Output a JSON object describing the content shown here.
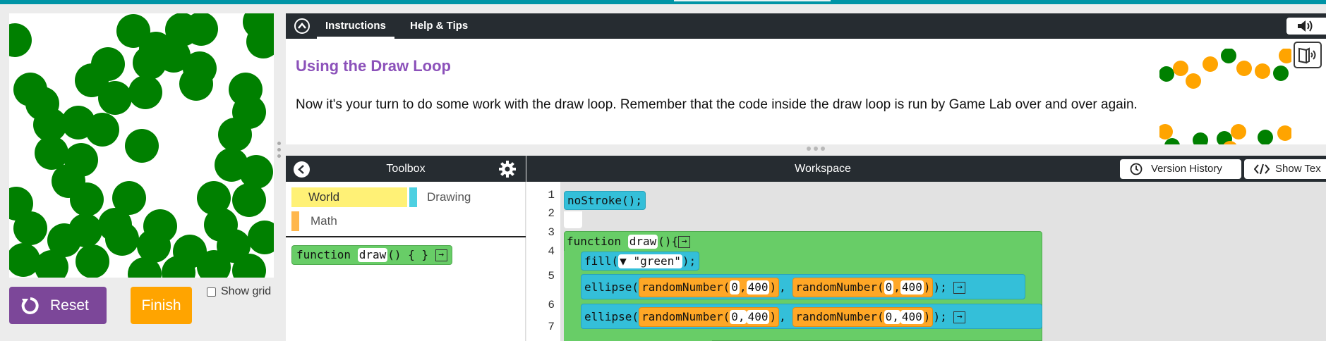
{
  "instructions": {
    "tabs": [
      "Instructions",
      "Help & Tips"
    ],
    "title": "Using the Draw Loop",
    "body": "Now it's your turn to do some work with the draw loop. Remember that the code inside the draw loop is run by Game Lab over and over again."
  },
  "visualization": {
    "reset_label": "Reset",
    "finish_label": "Finish",
    "show_grid_label": "Show grid"
  },
  "toolbox": {
    "title": "Toolbox",
    "categories": [
      "World",
      "Drawing",
      "Math"
    ],
    "block": {
      "keyword": "function",
      "name": "draw",
      "suffix": "()   { }"
    }
  },
  "workspace": {
    "title": "Workspace",
    "version_history_label": "Version History",
    "show_text_label": "Show Tex",
    "line_numbers": [
      "1",
      "2",
      "3",
      "4",
      "5",
      "6",
      "7"
    ],
    "code": {
      "line1": "noStroke();",
      "line3_keyword": "function",
      "line3_name": "draw",
      "line3_suffix": "(){",
      "line4_fn": "fill(",
      "line4_arg": "▼ \"green\"",
      "line4_end": ");",
      "line5_fn": "ellipse(",
      "line5_random": "randomNumber(",
      "line5_a": "0",
      "line5_comma": ",",
      "line5_b": "400",
      "line5_close": ")",
      "line5_sep": ",",
      "line5_end": ");",
      "line6_a": "0, ",
      "line6_b": "400"
    }
  },
  "colors": {
    "accent_purple": "#7c4799",
    "finish_orange": "#ffa400",
    "title_purple": "#8c52ba",
    "header_dark": "#262c31",
    "circle_green": "#008000"
  }
}
